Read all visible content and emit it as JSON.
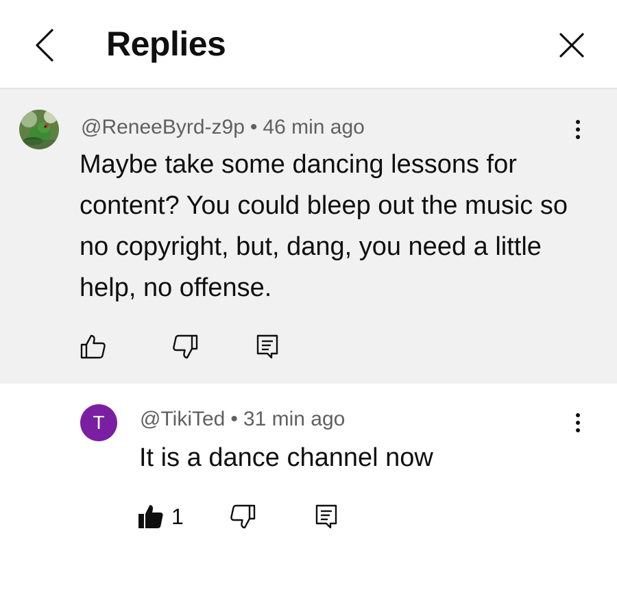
{
  "header": {
    "title": "Replies",
    "back_icon": "chevron-left-icon",
    "close_icon": "close-icon"
  },
  "parent_comment": {
    "author": "@ReneeByrd-z9p",
    "separator": "•",
    "time": "46 min ago",
    "text": "Maybe take some dancing lessons for content? You could bleep out the music so no copyright, but, dang, you need a little help, no offense.",
    "like_count": "",
    "icons": [
      "thumbs-up-outline-icon",
      "thumbs-down-outline-icon",
      "reply-icon",
      "more-vertical-icon"
    ]
  },
  "reply": {
    "avatar_letter": "T",
    "avatar_color": "#7b1fa2",
    "author": "@TikiTed",
    "separator": "•",
    "time": "31 min ago",
    "text": "It is a dance channel now",
    "like_count": "1",
    "liked": true,
    "icons": [
      "thumbs-up-filled-icon",
      "thumbs-down-outline-icon",
      "reply-icon",
      "more-vertical-icon"
    ]
  },
  "colors": {
    "parent_bg": "#f1f1f1",
    "meta_text": "#606060",
    "primary_text": "#0f0f0f"
  }
}
